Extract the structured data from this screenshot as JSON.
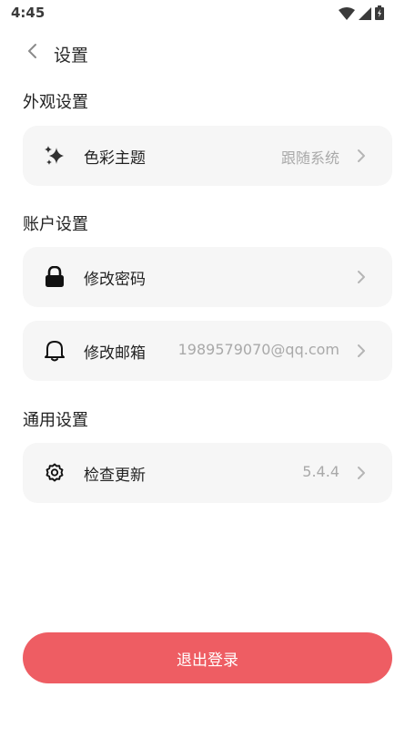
{
  "status_bar": {
    "time": "4:45",
    "icons": [
      "wifi-icon",
      "signal-icon",
      "battery-charging-icon"
    ]
  },
  "header": {
    "back_icon": "chevron-left-icon",
    "title": "设置"
  },
  "sections": {
    "appearance": {
      "title": "外观设置",
      "items": [
        {
          "icon": "sparkles-icon",
          "label": "色彩主题",
          "value": "跟随系统"
        }
      ]
    },
    "account": {
      "title": "账户设置",
      "items": [
        {
          "icon": "lock-icon",
          "label": "修改密码",
          "value": ""
        },
        {
          "icon": "bell-icon",
          "label": "修改邮箱",
          "value": "1989579070@qq.com"
        }
      ]
    },
    "general": {
      "title": "通用设置",
      "items": [
        {
          "icon": "gear-icon",
          "label": "检查更新",
          "value": "5.4.4"
        }
      ]
    }
  },
  "logout": {
    "label": "退出登录"
  },
  "colors": {
    "accent": "#ee5d63",
    "card_bg": "#f6f6f6",
    "muted_text": "#a9a9a9"
  }
}
